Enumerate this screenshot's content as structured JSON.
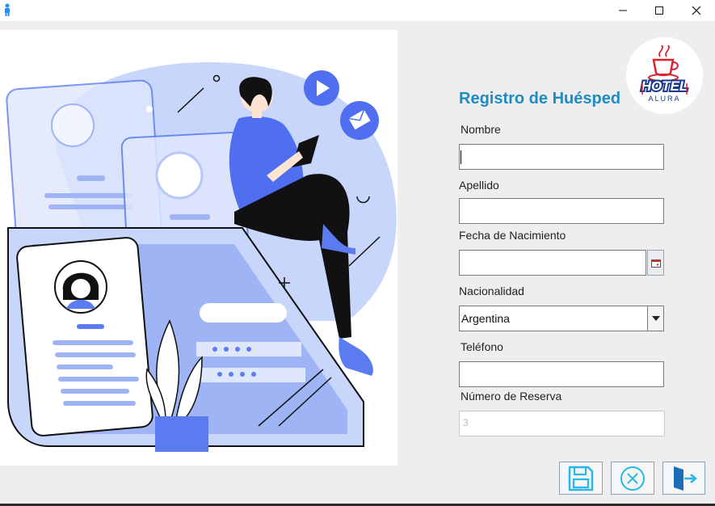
{
  "window": {
    "app_icon": "person-icon",
    "controls": [
      "minimize-icon",
      "maximize-icon",
      "close-icon"
    ]
  },
  "logo": {
    "line1": "HOTEL",
    "line2": "ALURA",
    "icon": "coffee-cup-icon"
  },
  "form": {
    "title": "Registro de Huésped",
    "nombre_label": "Nombre",
    "nombre_value": "",
    "apellido_label": "Apellido",
    "apellido_value": "",
    "fecha_label": "Fecha de Nacimiento",
    "fecha_value": "",
    "nacionalidad_label": "Nacionalidad",
    "nacionalidad_value": "Argentina",
    "telefono_label": "Teléfono",
    "telefono_value": "",
    "reserva_label": "Número de Reserva",
    "reserva_value": "3"
  },
  "actions": {
    "save_icon": "save-icon",
    "cancel_icon": "cancel-circle-icon",
    "exit_icon": "exit-door-icon"
  },
  "colors": {
    "accent": "#1e8bc3",
    "illustration_blue": "#5b7cf0",
    "illustration_light": "#c8d6fb",
    "logo_red": "#d9232e",
    "icon_cyan": "#29b6e8"
  }
}
